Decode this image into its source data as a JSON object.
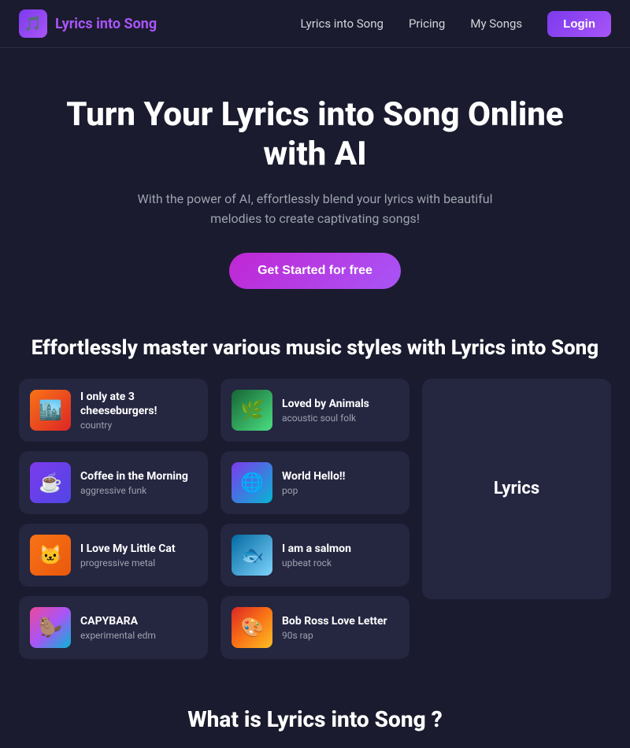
{
  "brand": {
    "icon": "🎵",
    "text_plain": "Lyrics into ",
    "text_accent": "Song"
  },
  "nav": {
    "links": [
      {
        "label": "Lyrics into Song",
        "id": "nav-home"
      },
      {
        "label": "Pricing",
        "id": "nav-pricing"
      },
      {
        "label": "My Songs",
        "id": "nav-mysongs"
      }
    ],
    "login_label": "Login"
  },
  "hero": {
    "title": "Turn Your Lyrics into Song Online with AI",
    "subtitle": "With the power of AI, effortlessly blend your lyrics with beautiful melodies to create captivating songs!",
    "cta": "Get Started for free"
  },
  "styles_section": {
    "title": "Effortlessly master various music styles with Lyrics into Song"
  },
  "column1_songs": [
    {
      "title": "I only ate 3 cheeseburgers!",
      "genre": "country",
      "thumb_class": "thumb-country",
      "emoji": "🏙️"
    },
    {
      "title": "Coffee in the Morning",
      "genre": "aggressive funk",
      "thumb_class": "thumb-coffee",
      "emoji": "☕"
    },
    {
      "title": "I Love My Little Cat",
      "genre": "progressive metal",
      "thumb_class": "thumb-cat",
      "emoji": "🐱"
    },
    {
      "title": "CAPYBARA",
      "genre": "experimental edm",
      "thumb_class": "thumb-capybara",
      "emoji": "🦫"
    }
  ],
  "column2_songs": [
    {
      "title": "Loved by Animals",
      "genre": "acoustic soul folk",
      "thumb_class": "thumb-animals",
      "emoji": "🌿"
    },
    {
      "title": "World Hello!!",
      "genre": "pop",
      "thumb_class": "thumb-world",
      "emoji": "🌐"
    },
    {
      "title": "I am a salmon",
      "genre": "upbeat rock",
      "thumb_class": "thumb-salmon",
      "emoji": "🐟"
    },
    {
      "title": "Bob Ross Love Letter",
      "genre": "90s rap",
      "thumb_class": "thumb-bob",
      "emoji": "🎨"
    }
  ],
  "column3": {
    "label": "Lyrics"
  },
  "bottom": {
    "title": "What is Lyrics into Song ?"
  }
}
